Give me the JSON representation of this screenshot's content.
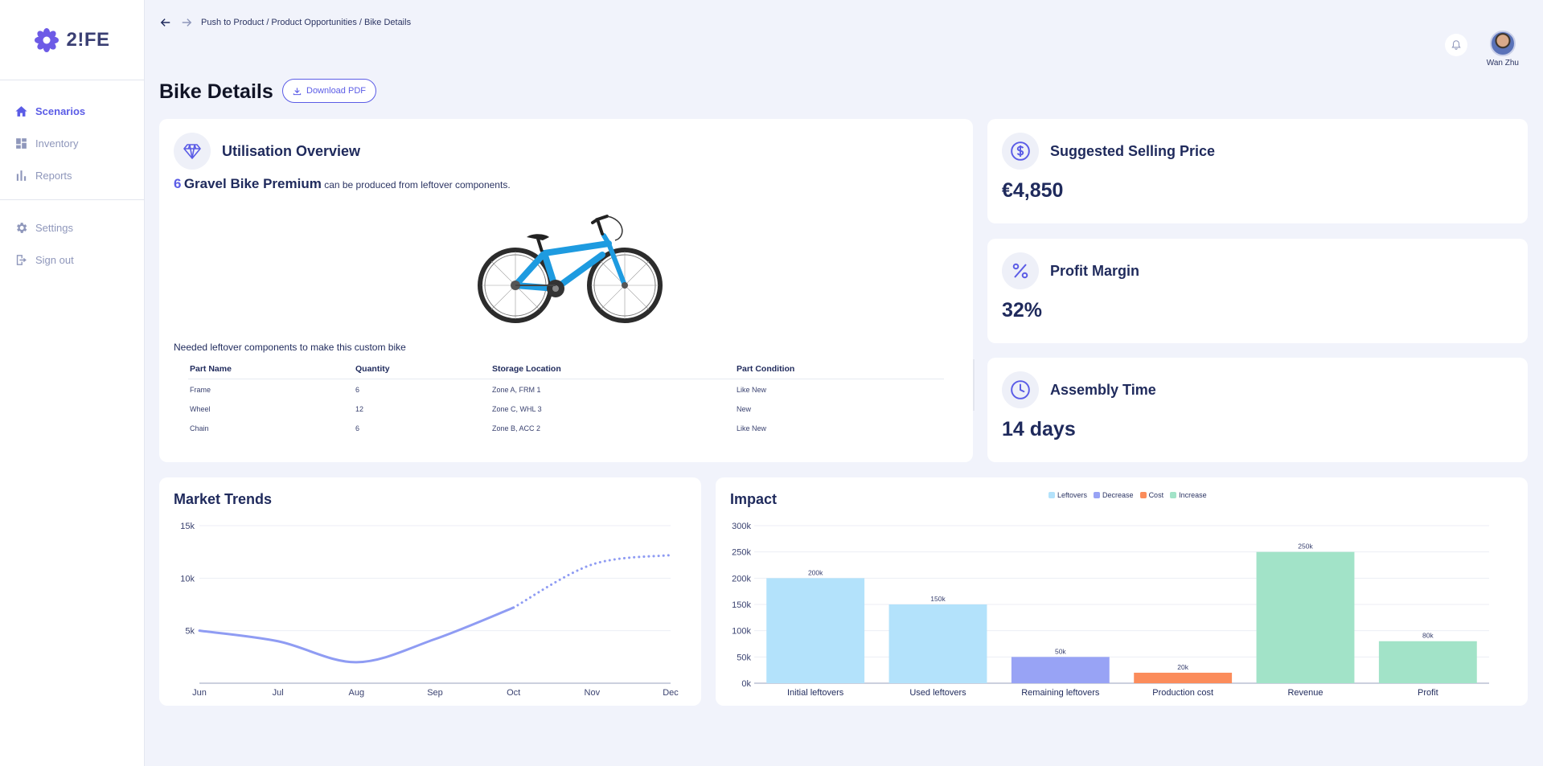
{
  "app": {
    "logo_text": "2!FE"
  },
  "sidebar": {
    "items": [
      {
        "label": "Scenarios",
        "icon": "home-icon"
      },
      {
        "label": "Inventory",
        "icon": "dashboard-icon"
      },
      {
        "label": "Reports",
        "icon": "bar-chart-icon"
      },
      {
        "label": "Settings",
        "icon": "gear-icon"
      },
      {
        "label": "Sign out",
        "icon": "sign-out-icon"
      }
    ]
  },
  "breadcrumb": "Push to Product / Product Opportunities / Bike Details",
  "user": {
    "name": "Wan Zhu"
  },
  "page": {
    "title": "Bike Details",
    "download_label": "Download PDF"
  },
  "utilisation": {
    "title": "Utilisation Overview",
    "count": "6",
    "product_name": "Gravel Bike Premium",
    "suffix": "can be produced from leftover components.",
    "needed_label": "Needed leftover components to make this custom bike",
    "columns": [
      "Part Name",
      "Quantity",
      "Storage Location",
      "Part Condition"
    ],
    "rows": [
      [
        "Frame",
        "6",
        "Zone A, FRM 1",
        "Like New"
      ],
      [
        "Wheel",
        "12",
        "Zone C, WHL 3",
        "New"
      ],
      [
        "Chain",
        "6",
        "Zone B, ACC 2",
        "Like New"
      ]
    ]
  },
  "price": {
    "title": "Suggested Selling Price",
    "value": "€4,850"
  },
  "margin": {
    "title": "Profit Margin",
    "value": "32%"
  },
  "assembly": {
    "title": "Assembly Time",
    "value": "14 days"
  },
  "colors": {
    "accent": "#5b5ce6",
    "leftovers": "#b3e2fb",
    "decrease": "#98a3f5",
    "cost": "#fb8c5b",
    "increase": "#a2e3c8",
    "trend_line": "#8f9cf3"
  },
  "chart_data": [
    {
      "type": "line",
      "title": "Market Trends",
      "x": [
        "Jun",
        "Jul",
        "Aug",
        "Sep",
        "Oct",
        "Nov",
        "Dec"
      ],
      "series": [
        {
          "values": [
            5000,
            4000,
            2000,
            4200,
            7200,
            null,
            null
          ]
        },
        {
          "values": [
            null,
            null,
            null,
            null,
            7200,
            11300,
            12200
          ],
          "style": "dotted"
        }
      ],
      "yticks": [
        "5k",
        "10k",
        "15k"
      ],
      "ylim": [
        0,
        15000
      ],
      "grid": true
    },
    {
      "type": "bar",
      "title": "Impact",
      "categories": [
        "Initial leftovers",
        "Used leftovers",
        "Remaining leftovers",
        "Production cost",
        "Revenue",
        "Profit"
      ],
      "values": [
        200000,
        150000,
        50000,
        20000,
        250000,
        80000
      ],
      "labels": [
        "200k",
        "150k",
        "50k",
        "20k",
        "250k",
        "80k"
      ],
      "kinds": [
        "Leftovers",
        "Leftovers",
        "Decrease",
        "Cost",
        "Increase",
        "Increase"
      ],
      "legend": [
        "Leftovers",
        "Decrease",
        "Cost",
        "Increase"
      ],
      "legend_position": "top",
      "yticks": [
        "0k",
        "50k",
        "100k",
        "150k",
        "200k",
        "250k",
        "300k"
      ],
      "ylim": [
        0,
        300000
      ],
      "grid": true
    }
  ]
}
